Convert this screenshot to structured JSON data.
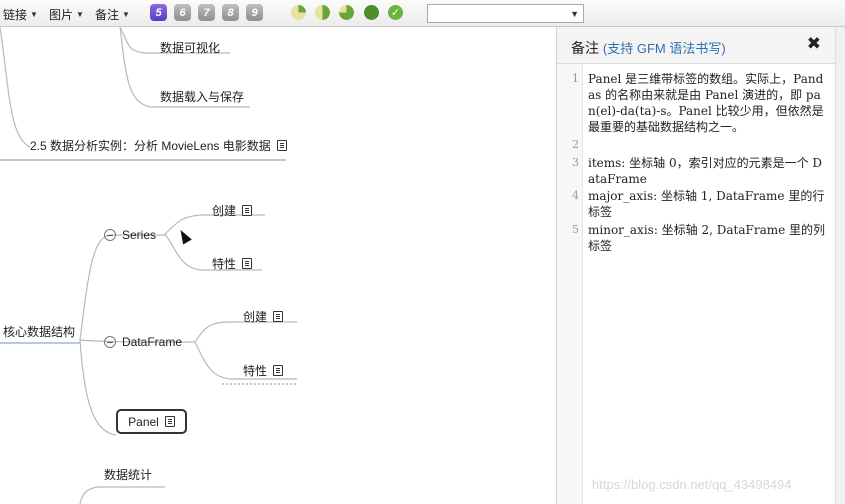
{
  "toolbar": {
    "menus": [
      {
        "label": "链接"
      },
      {
        "label": "图片"
      },
      {
        "label": "备注"
      }
    ],
    "priorities": [
      "5",
      "6",
      "7",
      "8",
      "9"
    ],
    "active_priority": "5",
    "progress_icons": [
      "progress-quarter-icon",
      "progress-half-icon",
      "progress-three-quarter-icon",
      "progress-full-icon",
      "progress-done-icon"
    ],
    "template_select_value": ""
  },
  "mindmap": {
    "nodes": {
      "data_visualization": "数据可视化",
      "data_load_save": "数据载入与保存",
      "case_study": "2.5 数据分析实例：分析 MovieLens 电影数据",
      "core_structures": "核心数据结构",
      "series": "Series",
      "series_create": "创建",
      "series_props": "特性",
      "dataframe": "DataFrame",
      "dataframe_create": "创建",
      "dataframe_props": "特性",
      "panel": "Panel",
      "data_stats": "数据统计"
    },
    "colors": {
      "branch": "#b9b9b9",
      "underline": "#9fb8d3"
    }
  },
  "note": {
    "title": "备注",
    "subtitle": "(支持 GFM 语法书写)",
    "lines": [
      {
        "num": "1",
        "text": "Panel 是三维带标签的数组。实际上，Pandas 的名称由来就是由 Panel 演进的，即 pan(el)-da(ta)-s。Panel 比较少用，但依然是最重要的基础数据结构之一。"
      },
      {
        "num": "2",
        "text": ""
      },
      {
        "num": "3",
        "text": "items: 坐标轴 0，索引对应的元素是一个 DataFrame"
      },
      {
        "num": "4",
        "text": "major_axis: 坐标轴 1, DataFrame 里的行标签"
      },
      {
        "num": "5",
        "text": "minor_axis: 坐标轴 2, DataFrame 里的列标签"
      }
    ]
  },
  "watermark": "https://blog.csdn.net/qq_43498494"
}
